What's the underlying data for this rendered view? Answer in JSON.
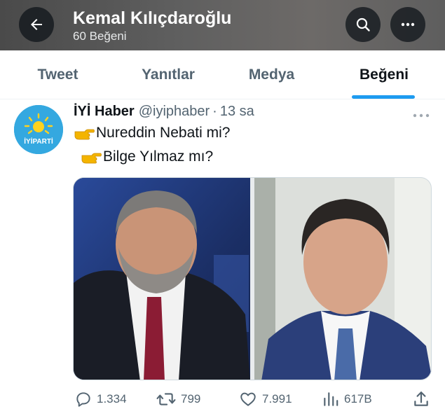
{
  "header": {
    "title": "Kemal Kılıçdaroğlu",
    "subtitle": "60 Beğeni",
    "back_icon": "arrow-left-icon",
    "search_icon": "search-icon",
    "more_icon": "more-horizontal-icon"
  },
  "tabs": [
    {
      "label": "Tweet",
      "active": false
    },
    {
      "label": "Yanıtlar",
      "active": false
    },
    {
      "label": "Medya",
      "active": false
    },
    {
      "label": "Beğeni",
      "active": true
    }
  ],
  "tweet": {
    "author_name": "İYİ Haber",
    "author_handle": "@iyiphaber",
    "time": "13 sa",
    "avatar_text": "İYİPARTİ",
    "lines": [
      "Nureddin Nebati mi?",
      "Bilge Yılmaz mı?"
    ],
    "stats": {
      "replies": "1.334",
      "retweets": "799",
      "likes": "7.991",
      "views": "617B"
    }
  },
  "colors": {
    "accent": "#1d9bf0",
    "secondary_text": "#536471",
    "avatar_bg": "#34a8e0"
  }
}
